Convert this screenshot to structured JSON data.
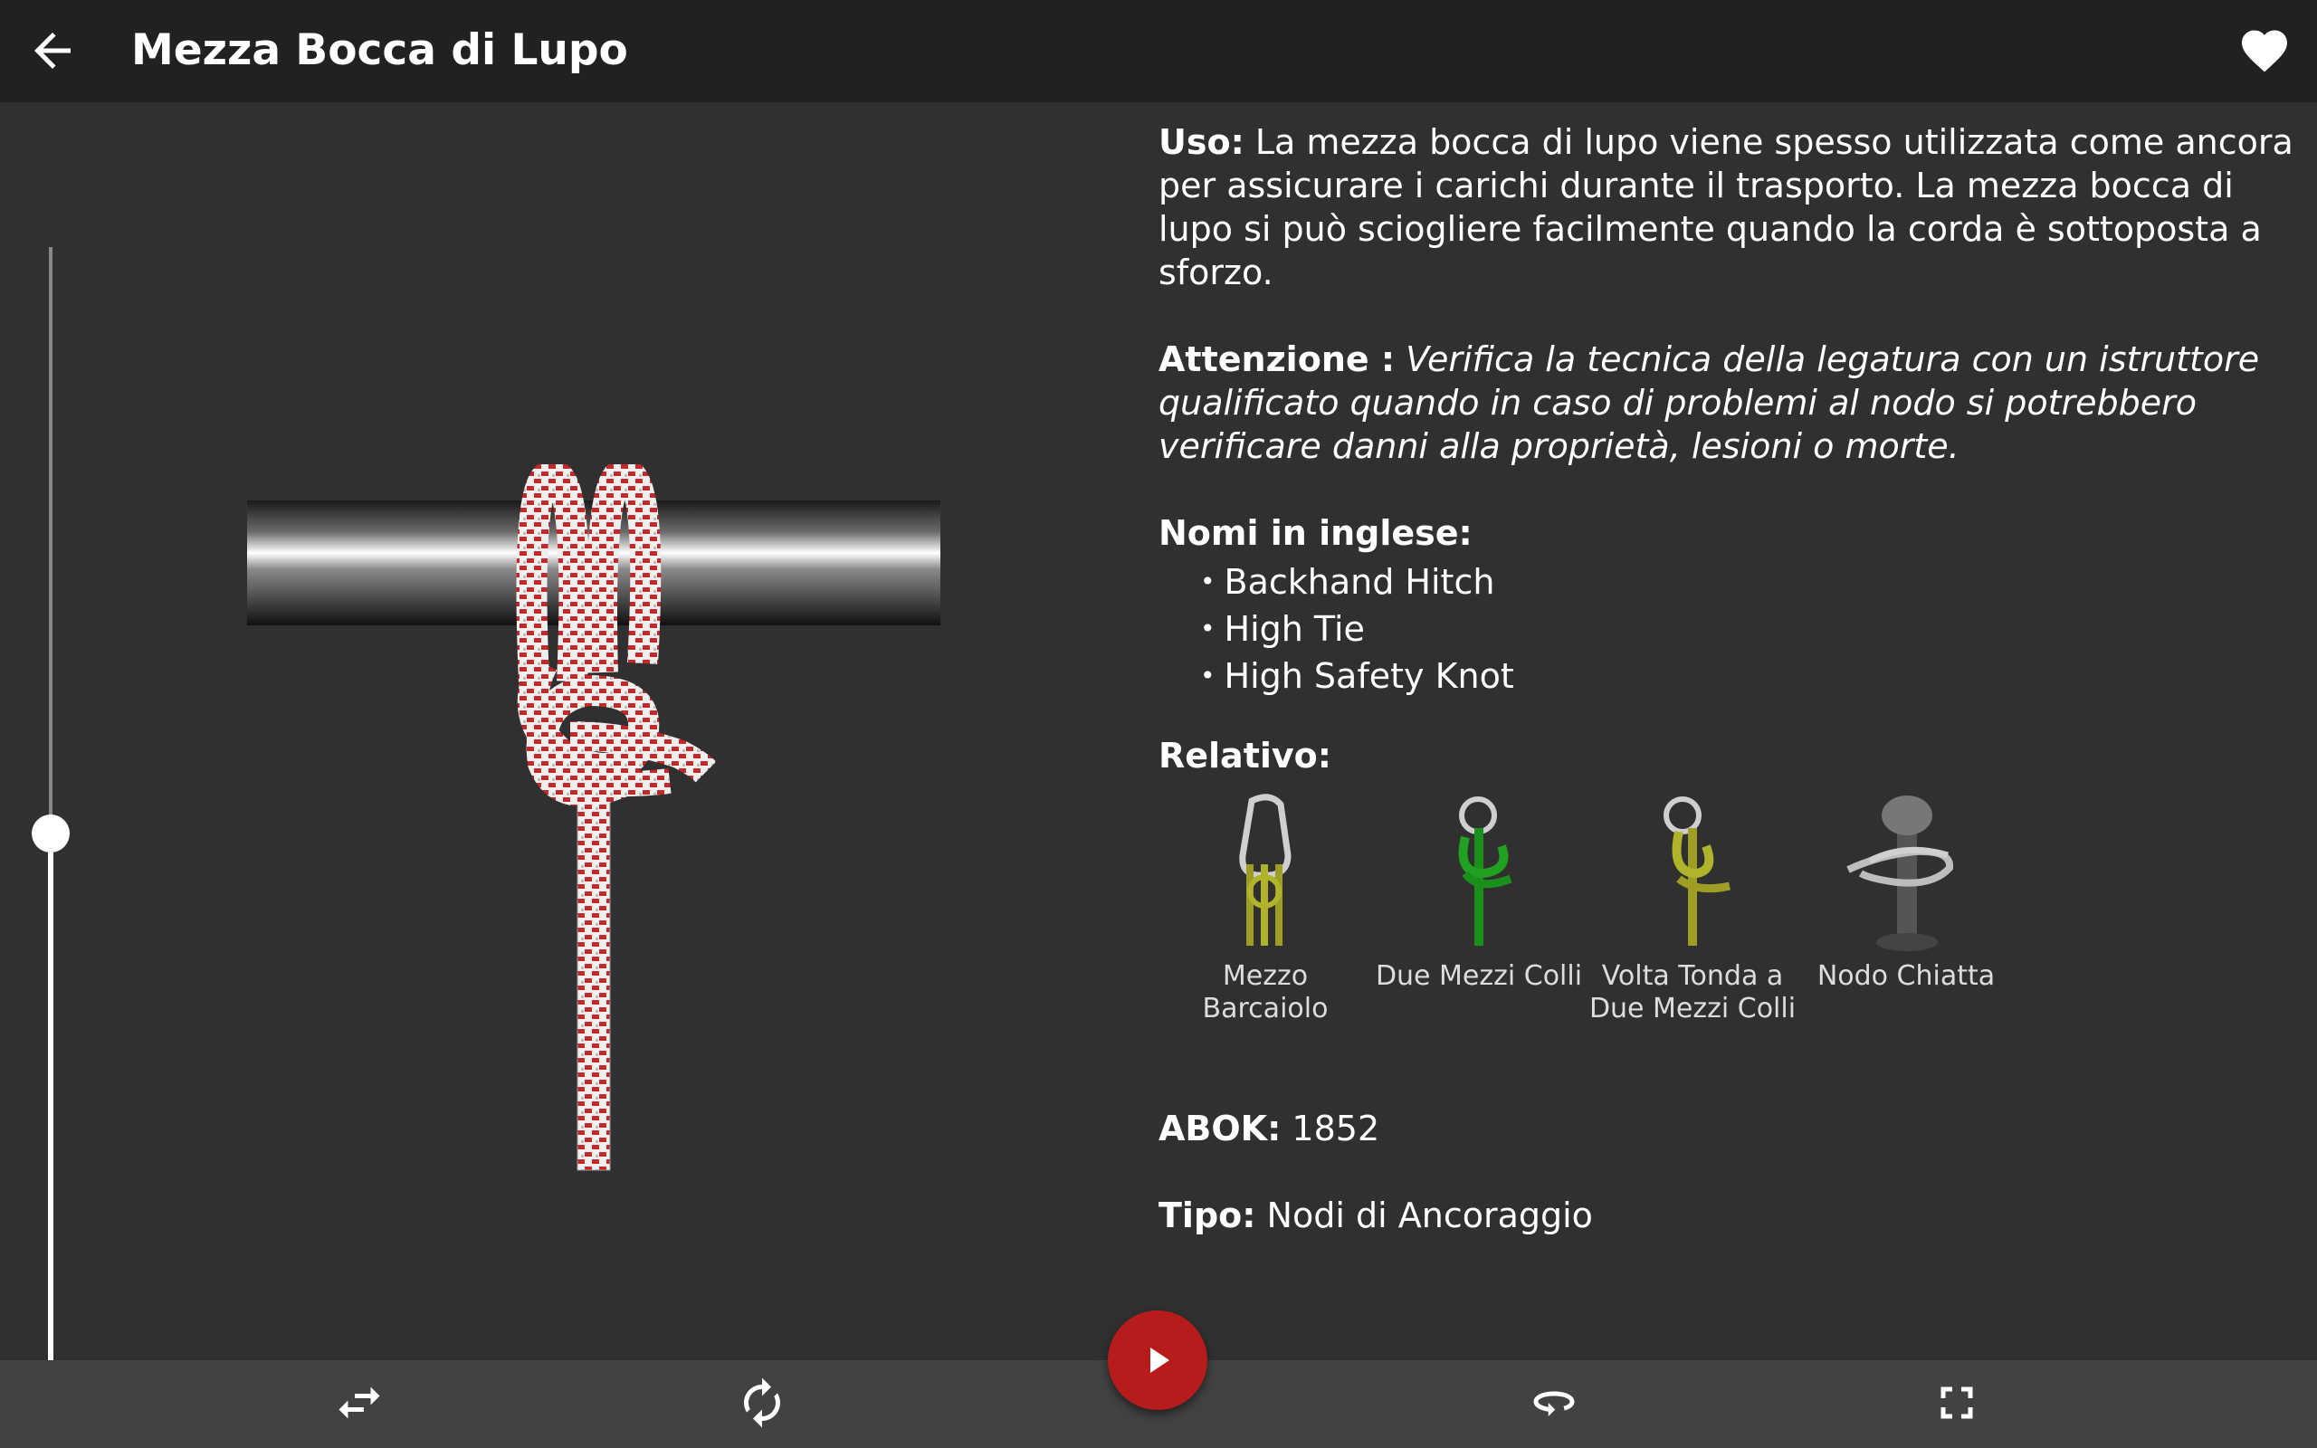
{
  "appbar": {
    "back_icon": "arrow-back-icon",
    "title": "Mezza Bocca di Lupo",
    "favorite_icon": "heart-icon"
  },
  "info": {
    "uso_label": "Uso:",
    "uso_text": "La mezza bocca di lupo viene spesso utilizzata come ancora per assicurare i carichi durante il trasporto. La mezza bocca di lupo si può sciogliere facilmente quando la corda è sottoposta a sforzo.",
    "attenzione_label": "Attenzione :",
    "attenzione_text": "Verifica la tecnica della legatura con un istruttore qualificato quando in caso di problemi al nodo si potrebbero verificare danni alla proprietà, lesioni o morte.",
    "english_names_label": "Nomi in inglese:",
    "english_names": [
      "Backhand Hitch",
      "High Tie",
      "High Safety Knot"
    ],
    "related_label": "Relativo:",
    "related": [
      {
        "label": "Mezzo Barcaiolo",
        "icon": "carabiner-knot-icon"
      },
      {
        "label": "Due Mezzi Colli",
        "icon": "ring-hitch-green-icon"
      },
      {
        "label": "Volta Tonda a Due Mezzi Colli",
        "icon": "ring-hitch-yellow-icon"
      },
      {
        "label": "Nodo Chiatta",
        "icon": "bollard-knot-icon"
      }
    ],
    "abok_label": "ABOK:",
    "abok_value": "1852",
    "tipo_label": "Tipo:",
    "tipo_value": "Nodi di Ancoraggio"
  },
  "slider": {
    "progress": 0.5
  },
  "controls": {
    "swap_icon": "swap-direction-icon",
    "rotate_icon": "rotate-icon",
    "play_icon": "play-icon",
    "loop_icon": "loop-icon",
    "fullscreen_icon": "fullscreen-icon"
  },
  "colors": {
    "appbar": "#212121",
    "background": "#303030",
    "bottombar": "#424242",
    "play_button": "#b71c1c",
    "rope_red": "#c62828",
    "rope_white": "#eeeeee"
  }
}
